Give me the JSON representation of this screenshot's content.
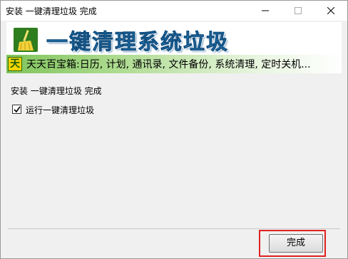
{
  "window": {
    "title": "安装 一键清理垃圾 完成",
    "buttons": [
      "minimize-icon",
      "maximize-icon",
      "close-icon"
    ]
  },
  "banner": {
    "app_icon": "broom-icon",
    "title": "一键清理系统垃圾",
    "brand_icon_char": "天",
    "promo_text": "天天百宝箱:日历, 计划, 通讯录, 文件备份, 系统清理, 定时关机..."
  },
  "content": {
    "status_text": "安装 一键清理垃圾 完成",
    "run_checkbox": {
      "label": "运行一键清理垃圾",
      "checked": true
    }
  },
  "footer": {
    "finish_label": "完成"
  },
  "colors": {
    "title_blue": "#2a88c8",
    "banner_green": "#7fc45b",
    "highlight_red": "#e02020"
  }
}
